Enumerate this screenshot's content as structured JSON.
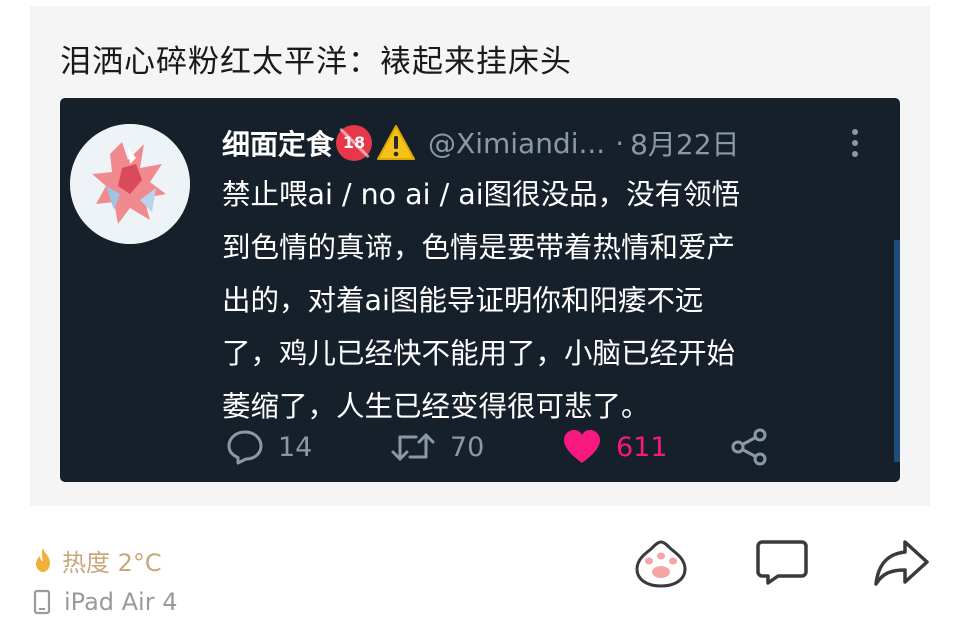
{
  "post": {
    "title": "泪洒心碎粉红太平洋：裱起来挂床头"
  },
  "tweet": {
    "display_name": "细面定食",
    "badge_18": "18",
    "handle": "@Ximiandi...",
    "separator": "·",
    "date": "8月22日",
    "body_lines": [
      "禁止喂ai / no ai / ai图很没品，没有领悟",
      "到色情的真谛，色情是要带着热情和爱产",
      "出的，对着ai图能导证明你和阳痿不远",
      "了，鸡儿已经快不能用了，小脑已经开始",
      "萎缩了，人生已经变得很可悲了。"
    ],
    "replies": "14",
    "retweets": "70",
    "likes": "611",
    "like_color": "#f91880",
    "background_color": "#15202b"
  },
  "footer": {
    "heat_label": "热度 2°C",
    "device_label": "iPad Air 4",
    "icons": [
      "flame-icon",
      "tablet-icon",
      "paw-icon",
      "comment-icon",
      "share-icon"
    ]
  }
}
